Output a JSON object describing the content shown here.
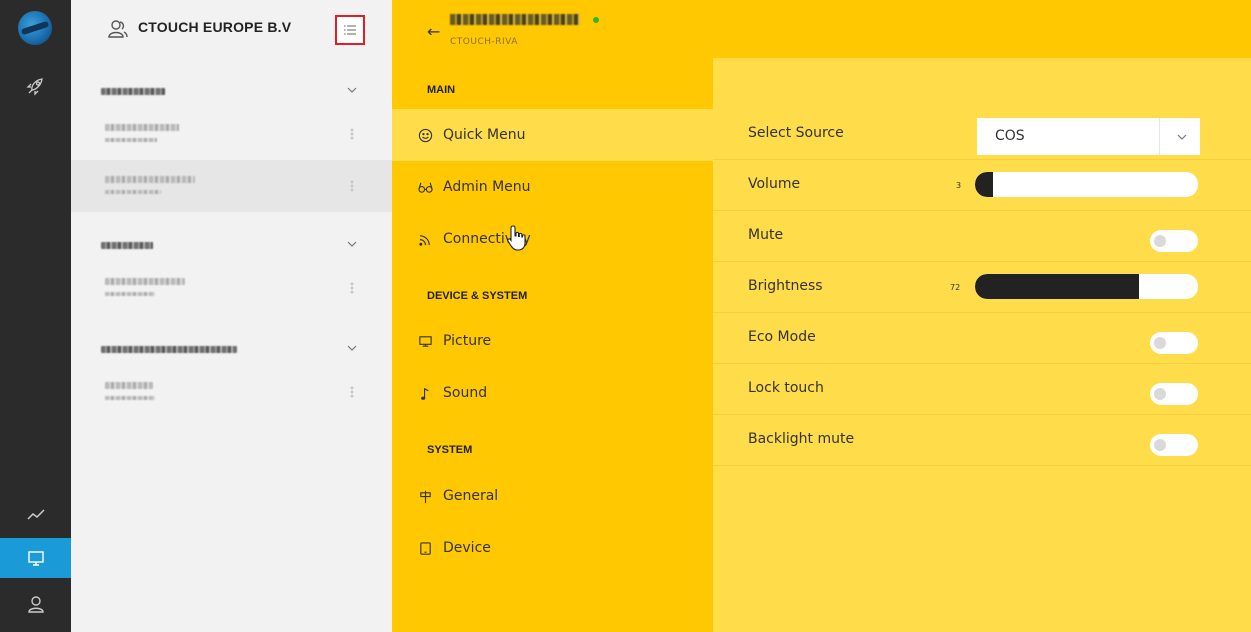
{
  "org": {
    "title": "CTOUCH EUROPE B.V"
  },
  "device": {
    "subtitle": "CTOUCH-RIVA"
  },
  "menu": {
    "sections": [
      {
        "title": "MAIN"
      },
      {
        "title": "DEVICE & SYSTEM"
      },
      {
        "title": "SYSTEM"
      }
    ],
    "items": [
      {
        "label": "Quick Menu",
        "icon": "smile-icon",
        "active": true
      },
      {
        "label": "Admin Menu",
        "icon": "glasses-icon"
      },
      {
        "label": "Connectivity",
        "icon": "wifi-icon"
      },
      {
        "label": "Picture",
        "icon": "monitor-icon"
      },
      {
        "label": "Sound",
        "icon": "music-note-icon"
      },
      {
        "label": "General",
        "icon": "signpost-icon"
      },
      {
        "label": "Device",
        "icon": "tablet-icon"
      }
    ]
  },
  "settings": {
    "source": {
      "label": "Select Source",
      "value": "COS"
    },
    "volume": {
      "label": "Volume",
      "value": "3"
    },
    "mute": {
      "label": "Mute",
      "on": false
    },
    "brightness": {
      "label": "Brightness",
      "value": "72"
    },
    "eco": {
      "label": "Eco Mode",
      "on": false
    },
    "lock": {
      "label": "Lock touch",
      "on": false
    },
    "backlight": {
      "label": "Backlight mute",
      "on": false
    }
  },
  "colors": {
    "accent_yellow": "#ffc800",
    "light_yellow": "#ffdc4a",
    "rail": "#2b2b2b",
    "rail_active": "#1a9ad6",
    "online": "#2eb82e"
  }
}
